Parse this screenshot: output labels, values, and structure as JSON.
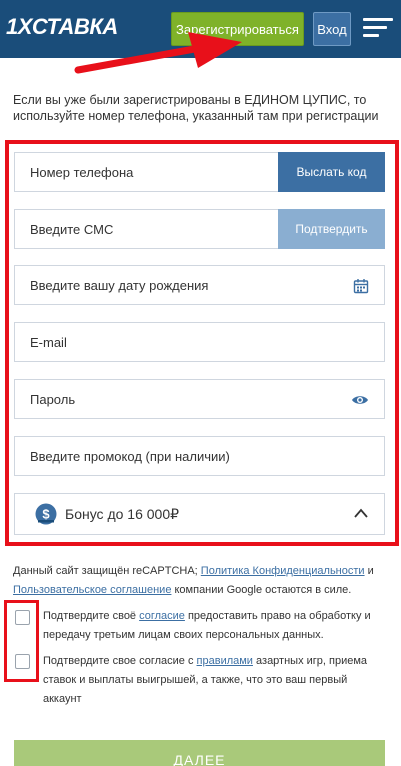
{
  "header": {
    "logo": "1XСТАВКА",
    "register_label": "Зарегистрироваться",
    "login_label": "Вход"
  },
  "intro_text": "Если вы уже были зарегистрированы в ЕДИНОМ ЦУПИС, то используйте номер телефона, указанный там при регистрации",
  "form": {
    "phone_label": "Номер телефона",
    "send_code_label": "Выслать код",
    "sms_label": "Введите СМС",
    "confirm_label": "Подтвердить",
    "birthdate_label": "Введите вашу дату рождения",
    "email_label": "E-mail",
    "password_label": "Пароль",
    "promo_label": "Введите промокод (при наличии)",
    "bonus_label": "Бонус до 16 000₽"
  },
  "recaptcha": {
    "prefix": "Данный сайт защищён reCAPTCHA; ",
    "privacy_link": "Политика Конфиденциальности",
    "and": " и ",
    "terms_link": "Пользовательское соглашение",
    "suffix": " компании Google остаются в силе."
  },
  "consent1": {
    "prefix": "Подтвердите своё ",
    "link": "согласие",
    "suffix": " предоставить право на обработку и передачу третьим лицам своих персональных данных."
  },
  "consent2": {
    "prefix": "Подтвердите свое согласие с ",
    "link": "правилами",
    "suffix": " азартных игр, приема ставок и выплаты выигрышей, а также, что это ваш первый аккаунт"
  },
  "next_label": "ДАЛЕЕ",
  "colors": {
    "header_bg": "#1a4d7a",
    "register_green": "#7fb229",
    "accent_blue": "#3c6fa3",
    "highlight_red": "#e8101a"
  }
}
